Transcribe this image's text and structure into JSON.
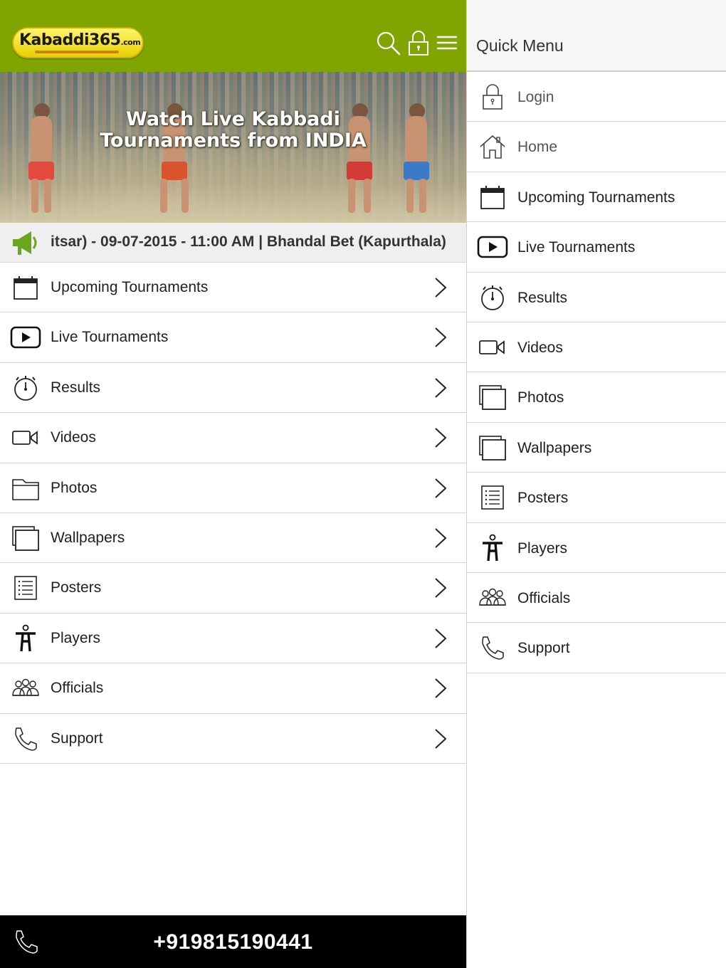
{
  "app": {
    "logo_text": "Kabaddi365",
    "logo_suffix": ".com",
    "brand_color": "#81a500",
    "header_icons": [
      "search-icon",
      "lock-icon",
      "hamburger-menu-icon"
    ]
  },
  "banner": {
    "title": "Watch Live Kabbadi\nTournaments from INDIA"
  },
  "ticker": {
    "icon": "megaphone-icon",
    "text": "itsar) - 09-07-2015 - 11:00 AM | Bhandal Bet (Kapurthala)"
  },
  "menu": {
    "items": [
      {
        "label": "Upcoming Tournaments",
        "icon": "calendar-icon"
      },
      {
        "label": "Live Tournaments",
        "icon": "play-icon"
      },
      {
        "label": "Results",
        "icon": "stopwatch-icon"
      },
      {
        "label": "Videos",
        "icon": "video-camera-icon"
      },
      {
        "label": "Photos",
        "icon": "photo-folder-icon"
      },
      {
        "label": "Wallpapers",
        "icon": "wallpapers-icon"
      },
      {
        "label": "Posters",
        "icon": "list-icon"
      },
      {
        "label": "Players",
        "icon": "player-icon"
      },
      {
        "label": "Officials",
        "icon": "officials-group-icon"
      },
      {
        "label": "Support",
        "icon": "phone-icon"
      }
    ]
  },
  "call_bar": {
    "number": "+919815190441",
    "icon": "phone-icon"
  },
  "quick_menu": {
    "title": "Quick Menu",
    "items": [
      {
        "label": "Login",
        "icon": "lock-icon"
      },
      {
        "label": "Home",
        "icon": "home-icon"
      },
      {
        "label": "Upcoming Tournaments",
        "icon": "calendar-icon"
      },
      {
        "label": "Live Tournaments",
        "icon": "play-icon"
      },
      {
        "label": "Results",
        "icon": "stopwatch-icon"
      },
      {
        "label": "Videos",
        "icon": "video-camera-icon"
      },
      {
        "label": "Photos",
        "icon": "photos-icon"
      },
      {
        "label": "Wallpapers",
        "icon": "wallpapers-icon"
      },
      {
        "label": "Posters",
        "icon": "list-icon"
      },
      {
        "label": "Players",
        "icon": "player-icon"
      },
      {
        "label": "Officials",
        "icon": "officials-group-icon"
      },
      {
        "label": "Support",
        "icon": "phone-icon"
      }
    ]
  }
}
